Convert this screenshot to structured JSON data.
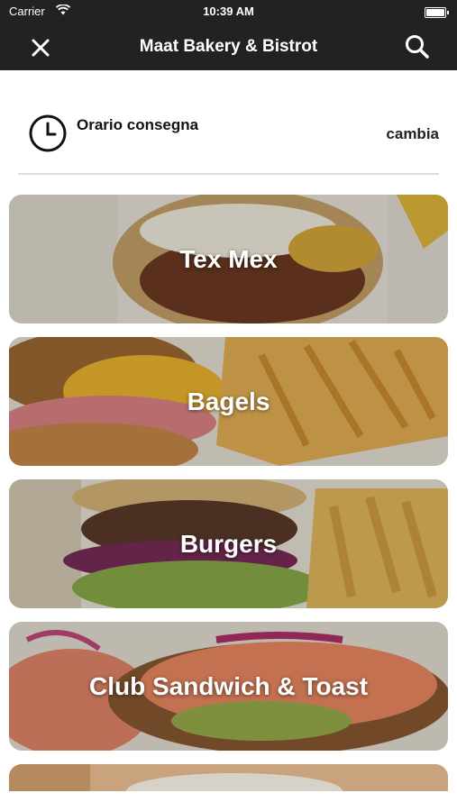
{
  "status": {
    "carrier": "Carrier",
    "time": "10:39 AM"
  },
  "nav": {
    "title": "Maat Bakery & Bistrot"
  },
  "delivery": {
    "label": "Orario consegna",
    "action": "cambia"
  },
  "categories": [
    {
      "label": "Tex Mex"
    },
    {
      "label": "Bagels"
    },
    {
      "label": "Burgers"
    },
    {
      "label": "Club Sandwich & Toast"
    }
  ],
  "colors": {
    "header": "#222222",
    "divider": "#dcdcdc",
    "text": "#111111"
  }
}
